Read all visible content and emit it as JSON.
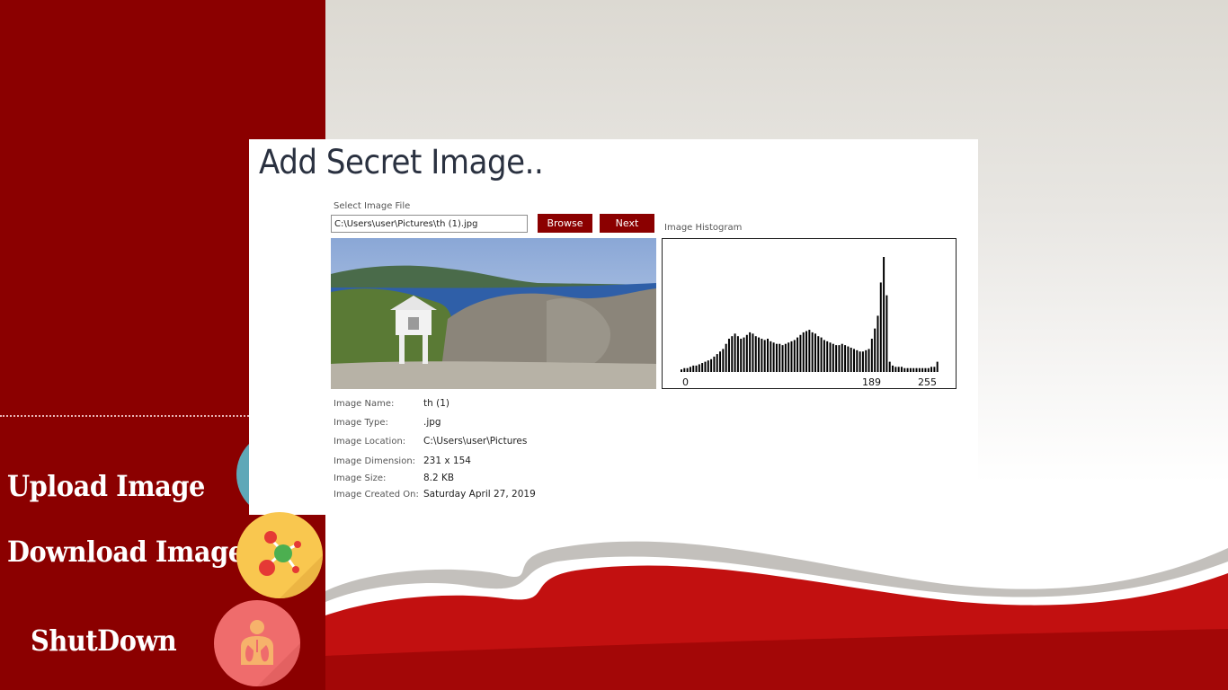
{
  "card": {
    "title": "Add Secret Image..",
    "select_label": "Select Image File",
    "file_path": "C:\\Users\\user\\Pictures\\th (1).jpg",
    "browse_label": "Browse",
    "next_label": "Next",
    "histogram_label": "Image Histogram"
  },
  "histogram": {
    "tick_labels": [
      "0",
      "189",
      "255"
    ],
    "bins": [
      2,
      3,
      3,
      4,
      5,
      5,
      6,
      7,
      8,
      9,
      10,
      12,
      14,
      16,
      18,
      22,
      26,
      28,
      30,
      28,
      26,
      27,
      29,
      31,
      30,
      28,
      27,
      26,
      25,
      26,
      24,
      23,
      22,
      22,
      21,
      22,
      23,
      24,
      25,
      27,
      29,
      31,
      32,
      33,
      31,
      30,
      28,
      27,
      25,
      24,
      23,
      22,
      21,
      21,
      22,
      21,
      20,
      19,
      18,
      17,
      16,
      16,
      17,
      18,
      26,
      34,
      44,
      70,
      90,
      60,
      8,
      5,
      4,
      4,
      4,
      3,
      3,
      3,
      3,
      3,
      3,
      3,
      3,
      3,
      4,
      4,
      8
    ]
  },
  "info": {
    "name_key": "Image Name:",
    "name_val": "th (1)",
    "type_key": "Image Type:",
    "type_val": ".jpg",
    "location_key": "Image Location:",
    "location_val": "C:\\Users\\user\\Pictures",
    "dimension_key": "Image Dimension:",
    "dimension_val": "231 x 154",
    "size_key": "Image Size:",
    "size_val": "8.2 KB",
    "created_key": "Image Created On:",
    "created_val": "Saturday April 27, 2019"
  },
  "menu": {
    "upload": "Upload Image",
    "download": "Download Image",
    "shutdown": "ShutDown"
  },
  "colors": {
    "brand_red": "#8b0000",
    "accent_yellow": "#f9c74f",
    "accent_coral": "#ef6c6c",
    "accent_teal": "#5fa8b8"
  },
  "icons": {
    "upload": "upload-circle-icon",
    "download": "molecule-icon",
    "shutdown": "lungs-person-icon"
  }
}
